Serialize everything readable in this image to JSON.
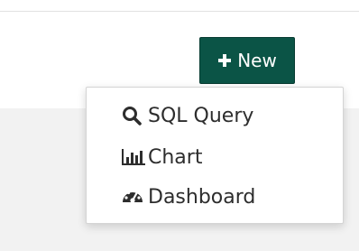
{
  "header": {
    "new_button_label": "New",
    "new_button_icon": "plus-icon",
    "accent_color": "#0b5446"
  },
  "new_menu": {
    "items": [
      {
        "label": "SQL Query",
        "icon": "search-icon"
      },
      {
        "label": "Chart",
        "icon": "bar-chart-icon"
      },
      {
        "label": "Dashboard",
        "icon": "gauge-icon"
      }
    ]
  }
}
